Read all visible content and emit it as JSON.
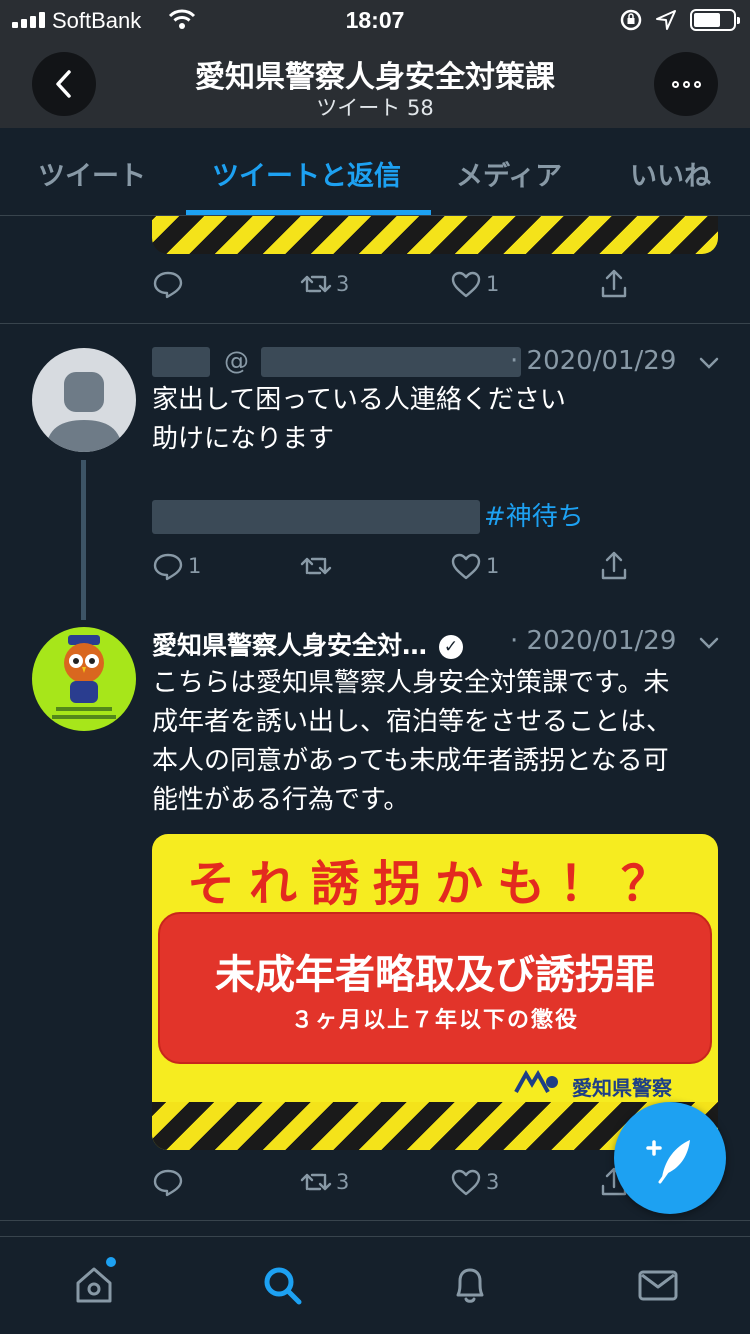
{
  "status_bar": {
    "carrier": "SoftBank",
    "time": "18:07"
  },
  "header": {
    "title": "愛知県警察人身安全対策課",
    "subtitle": "ツイート 58"
  },
  "tabs": [
    {
      "label": "ツイート",
      "active": false
    },
    {
      "label": "ツイートと返信",
      "active": true
    },
    {
      "label": "メディア",
      "active": false
    },
    {
      "label": "いいね",
      "active": false
    }
  ],
  "tweets": [
    {
      "retweets": "3",
      "likes": "1"
    },
    {
      "at_prefix": "@",
      "date": "· 2020/01/29",
      "lines": [
        "家出して困っている人連絡ください",
        "助けになります"
      ],
      "hashtag": "#神待ち",
      "replies": "1",
      "likes": "1"
    },
    {
      "name": "愛知県警察人身安全対…",
      "date": "· 2020/01/29",
      "lines": [
        "こちらは愛知県警察人身安全対策課です。未",
        "成年者を誘い出し、宿泊等をさせることは、",
        "本人の同意があっても未成年者誘拐となる可",
        "能性がある行為です。"
      ],
      "image": {
        "headline": "それ誘拐かも！？",
        "main": "未成年者略取及び誘拐罪",
        "sub": "３ヶ月以上７年以下の懲役",
        "logo_text": "愛知県警察"
      },
      "retweets": "3",
      "likes": "3"
    }
  ],
  "colors": {
    "background": "#15202b",
    "accent": "#1da1f2",
    "muted": "#8899a6"
  }
}
